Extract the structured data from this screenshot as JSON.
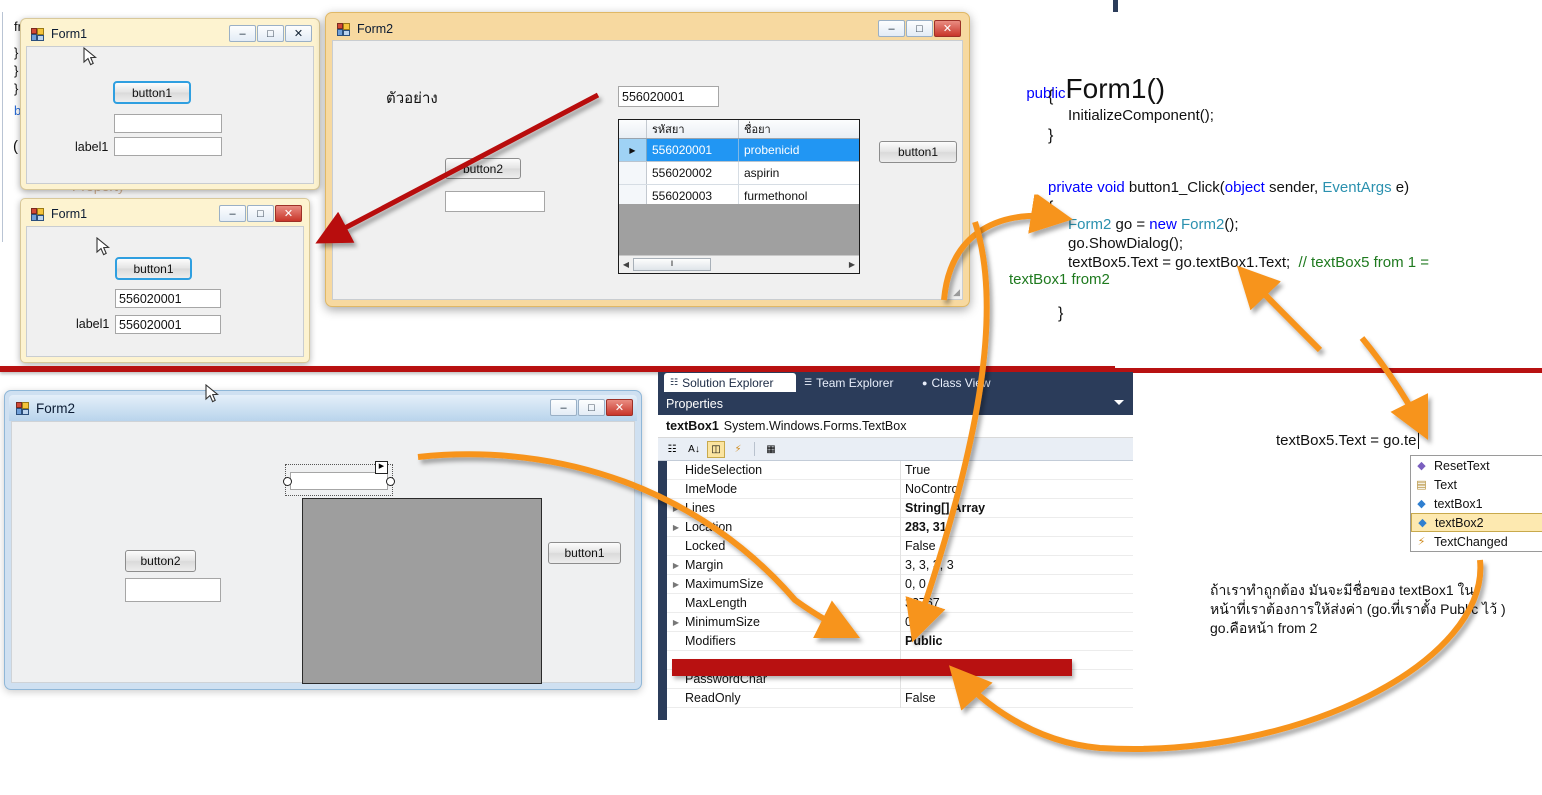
{
  "background_code": {
    "fragments": [
      "fr",
      "}",
      "}",
      "}",
      "b",
      "("
    ]
  },
  "form1_run": {
    "title": "Form1",
    "button_label": "button1",
    "textbox1_value": "",
    "label1": "label1",
    "textbox2_value": "",
    "buttons": {
      "minimize": "–",
      "maximize": "□",
      "close": "✕"
    }
  },
  "form1_result": {
    "title": "Form1",
    "button_label": "button1",
    "textbox1_value": "556020001",
    "label1": "label1",
    "textbox2_value": "556020001",
    "buttons": {
      "minimize": "–",
      "maximize": "□",
      "close": "✕"
    }
  },
  "form2_run": {
    "title": "Form2",
    "example_label": "ตัวอย่าง",
    "button2_label": "button2",
    "button1_label": "button1",
    "textbox_under_button2": "",
    "search_value": "556020001",
    "buttons": {
      "minimize": "–",
      "maximize": "□",
      "close": "✕"
    },
    "grid": {
      "columns": [
        "",
        "รหัสยา",
        "ชื่อยา"
      ],
      "rows": [
        {
          "marker": "▶",
          "code": "556020001",
          "name": "probenicid",
          "selected": true
        },
        {
          "marker": "",
          "code": "556020002",
          "name": "aspirin",
          "selected": false
        },
        {
          "marker": "",
          "code": "556020003",
          "name": "furmethonol",
          "selected": false
        }
      ],
      "scroll_thumb": "‖"
    }
  },
  "form2_design": {
    "title": "Form2",
    "button2_label": "button2",
    "button1_label": "button1",
    "textbox_value": "",
    "selected_textbox_value": "",
    "buttons": {
      "minimize": "–",
      "maximize": "□",
      "close": "✕"
    }
  },
  "code_panel": {
    "line1_kw": "public",
    "line1_name": "Form1()",
    "brace_open": "{",
    "init_call": "InitializeComponent();",
    "brace_close": "}",
    "sig_kw1": "private",
    "sig_kw2": "void",
    "sig_name": "button1_Click(",
    "sig_kw3": "object",
    "sig_p1": " sender, ",
    "sig_ty": "EventArgs",
    "sig_p2": " e)",
    "body_brace_open": "{",
    "l1_ty": "Form2",
    "l1_mid": " go = ",
    "l1_kw": "new",
    "l1_ty2": " Form2",
    "l1_end": "();",
    "l2": "go.ShowDialog();",
    "l3": "textBox5.Text = go.textBox1.Text;",
    "l3_comment": "// textBox5 from 1 =",
    "l4_comment": "textBox1 from2",
    "body_brace_close": "}"
  },
  "intellisense": {
    "typed_line": "textBox5.Text = go.te",
    "items": [
      {
        "label": "ResetText",
        "glyph": "◆",
        "selected": false
      },
      {
        "label": "Text",
        "glyph": "▤",
        "selected": false
      },
      {
        "label": "textBox1",
        "glyph": "◆",
        "selected": false
      },
      {
        "label": "textBox2",
        "glyph": "◆",
        "selected": true
      },
      {
        "label": "TextChanged",
        "glyph": "⚡",
        "selected": false
      }
    ]
  },
  "properties_panel": {
    "tabs": [
      {
        "label": "Solution Explorer",
        "active": true
      },
      {
        "label": "Team Explorer",
        "active": false
      },
      {
        "label": "Class View",
        "active": false
      }
    ],
    "title": "Properties",
    "object_name": "textBox1",
    "object_type": "System.Windows.Forms.TextBox",
    "toolbar_icons": [
      "categorized-icon",
      "alphabetical-icon",
      "properties-icon",
      "events-icon",
      "property-pages-icon"
    ],
    "rows": [
      {
        "name": "HideSelection",
        "value": "True",
        "expandable": false,
        "bold": false
      },
      {
        "name": "ImeMode",
        "value": "NoControl",
        "expandable": false,
        "bold": false
      },
      {
        "name": "Lines",
        "value": "String[] Array",
        "expandable": true,
        "bold": true
      },
      {
        "name": "Location",
        "value": "283, 31",
        "expandable": true,
        "bold": true
      },
      {
        "name": "Locked",
        "value": "False",
        "expandable": false,
        "bold": false
      },
      {
        "name": "Margin",
        "value": "3, 3, 3, 3",
        "expandable": true,
        "bold": false
      },
      {
        "name": "MaximumSize",
        "value": "0, 0",
        "expandable": true,
        "bold": false
      },
      {
        "name": "MaxLength",
        "value": "32767",
        "expandable": false,
        "bold": false
      },
      {
        "name": "MinimumSize",
        "value": "0, 0",
        "expandable": true,
        "bold": false
      },
      {
        "name": "Modifiers",
        "value": "Public",
        "expandable": false,
        "bold": true
      },
      {
        "name": "",
        "value": "",
        "expandable": false,
        "bold": false
      },
      {
        "name": "PasswordChar",
        "value": "",
        "expandable": false,
        "bold": false
      },
      {
        "name": "ReadOnly",
        "value": "False",
        "expandable": false,
        "bold": false
      }
    ]
  },
  "annotation": {
    "thai_note_line1": "ถ้าเราทำถูกต้อง มันจะมีชื่อของ  textBox1 ใน",
    "thai_note_line2": "หน้าที่เราต้องการให้ส่งค่า (go.ที่เราตั้ง Public ไว้ )",
    "thai_note_line3": "go.คือหน้า from 2"
  },
  "colors": {
    "arrow_red": "#b81111",
    "arrow_orange": "#f7941e",
    "grid_selection_blue": "#2196f3",
    "vs_navy": "#2b3c5a",
    "form1_titlebar": "#fdf3d0"
  }
}
